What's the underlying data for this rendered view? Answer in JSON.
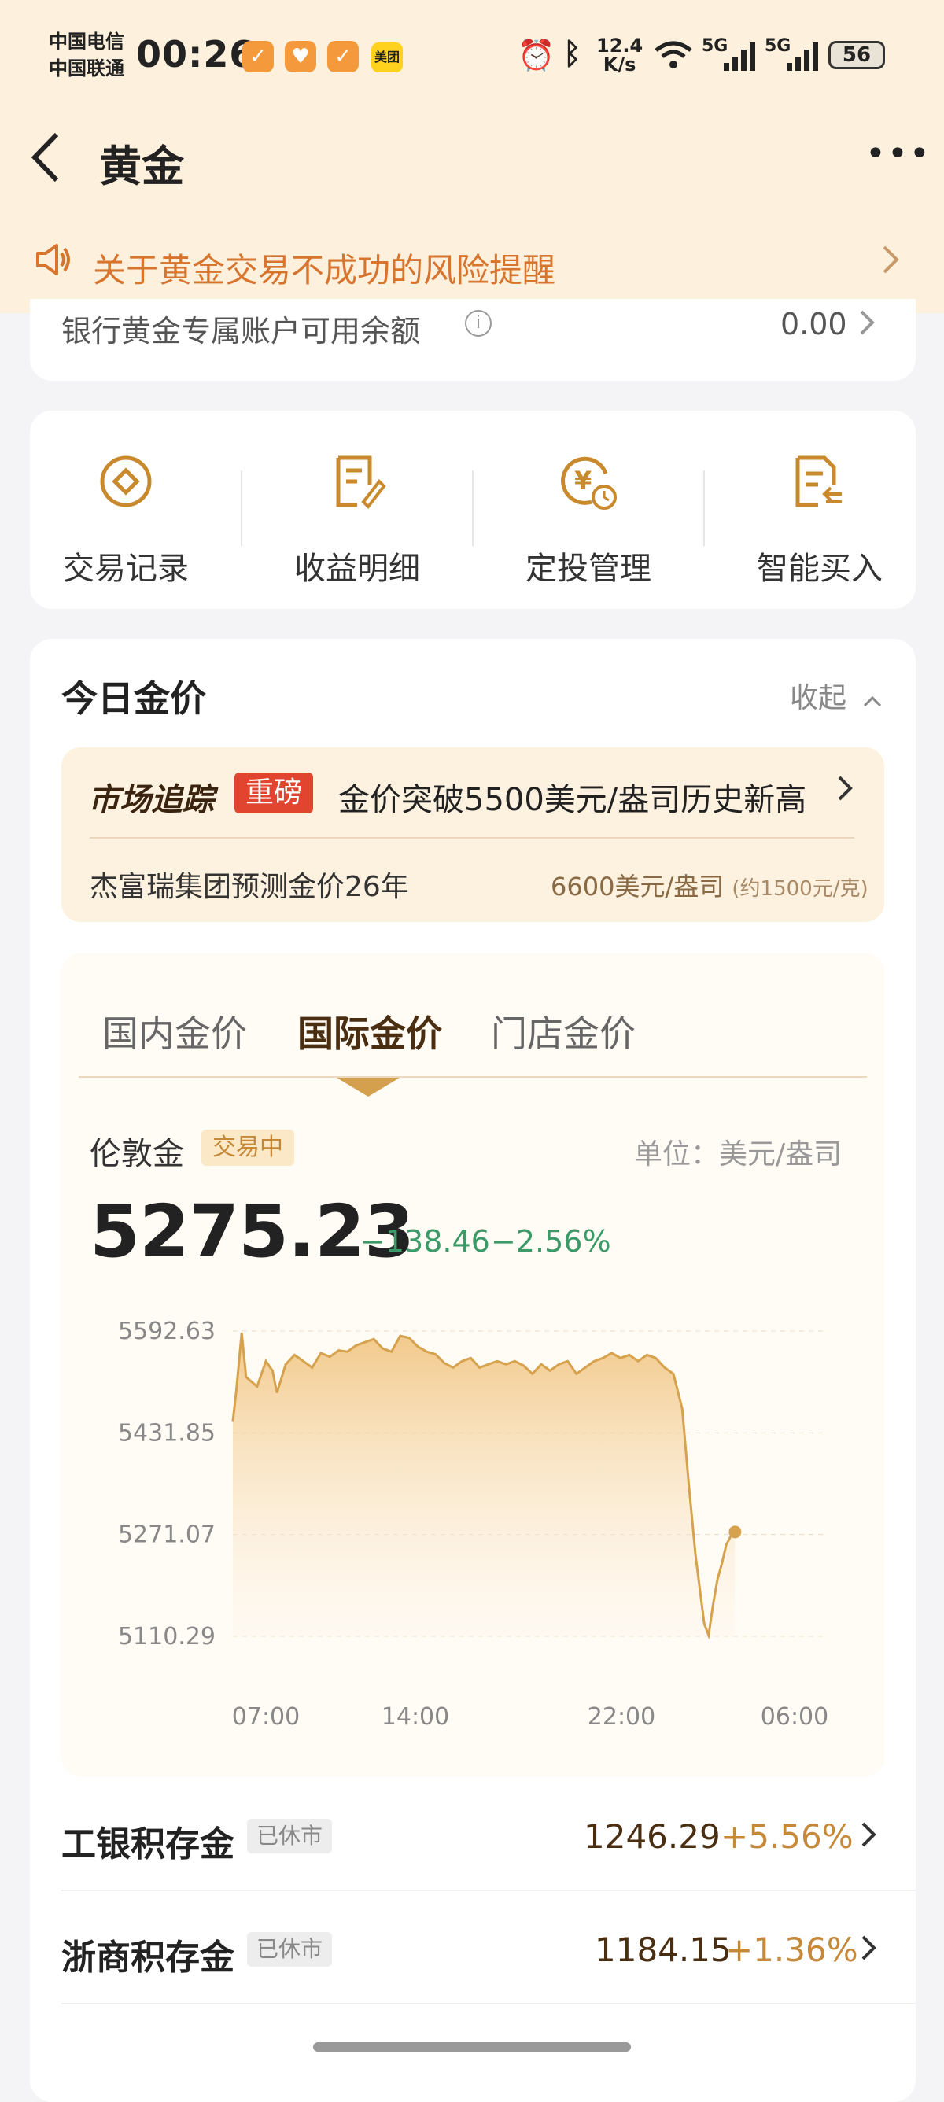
{
  "status_bar": {
    "carrier_1": "中国电信",
    "carrier_2": "中国联通",
    "time": "00:26",
    "meituan": "美团",
    "speed_value": "12.4",
    "speed_unit": "K/s",
    "net_1": "5G",
    "net_2": "5G",
    "battery": "56"
  },
  "header": {
    "title": "黄金"
  },
  "notice": {
    "text": "关于黄金交易不成功的风险提醒"
  },
  "balance": {
    "label": "银行黄金专属账户可用余额",
    "value": "0.00"
  },
  "functions": [
    {
      "label": "交易记录",
      "icon": "record-icon"
    },
    {
      "label": "收益明细",
      "icon": "income-detail-icon"
    },
    {
      "label": "定投管理",
      "icon": "fixed-invest-icon"
    },
    {
      "label": "智能买入",
      "icon": "smart-buy-icon"
    }
  ],
  "today": {
    "title": "今日金价",
    "collapse": "收起",
    "news": {
      "logo": "市场追踪",
      "badge": "重磅",
      "headline": "金价突破5500美元/盎司历史新高",
      "sub": "杰富瑞集团预测金价26年",
      "value": "6600美元/盎司",
      "value_sub": "(约1500元/克)"
    },
    "tabs": [
      "国内金价",
      "国际金价",
      "门店金价"
    ],
    "quote": {
      "name": "伦敦金",
      "status": "交易中",
      "unit": "单位：美元/盎司",
      "price": "5275.23",
      "change": "−138.46",
      "pct": "−2.56%"
    }
  },
  "chart_data": {
    "type": "area",
    "y_ticks": [
      "5592.63",
      "5431.85",
      "5271.07",
      "5110.29"
    ],
    "x_ticks": [
      "07:00",
      "14:00",
      "22:00",
      "06:00"
    ],
    "ylim": [
      5110.29,
      5592.63
    ],
    "series": [
      {
        "values": [
          [
            0,
            5450
          ],
          [
            0.08,
            5500
          ],
          [
            0.2,
            5590
          ],
          [
            0.3,
            5520
          ],
          [
            0.55,
            5505
          ],
          [
            0.75,
            5545
          ],
          [
            0.9,
            5530
          ],
          [
            1.0,
            5495
          ],
          [
            1.2,
            5540
          ],
          [
            1.4,
            5555
          ],
          [
            1.6,
            5545
          ],
          [
            1.8,
            5535
          ],
          [
            2.0,
            5558
          ],
          [
            2.2,
            5552
          ],
          [
            2.4,
            5562
          ],
          [
            2.6,
            5560
          ],
          [
            2.8,
            5570
          ],
          [
            3.0,
            5575
          ],
          [
            3.2,
            5580
          ],
          [
            3.4,
            5565
          ],
          [
            3.6,
            5560
          ],
          [
            3.8,
            5585
          ],
          [
            4.0,
            5582
          ],
          [
            4.2,
            5568
          ],
          [
            4.4,
            5560
          ],
          [
            4.6,
            5556
          ],
          [
            4.8,
            5542
          ],
          [
            5.0,
            5535
          ],
          [
            5.2,
            5545
          ],
          [
            5.4,
            5550
          ],
          [
            5.6,
            5535
          ],
          [
            5.8,
            5540
          ],
          [
            6.0,
            5545
          ],
          [
            6.2,
            5540
          ],
          [
            6.4,
            5545
          ],
          [
            6.6,
            5538
          ],
          [
            6.8,
            5525
          ],
          [
            7.0,
            5540
          ],
          [
            7.2,
            5530
          ],
          [
            7.4,
            5540
          ],
          [
            7.6,
            5545
          ],
          [
            7.8,
            5525
          ],
          [
            8.0,
            5535
          ],
          [
            8.2,
            5545
          ],
          [
            8.4,
            5550
          ],
          [
            8.6,
            5558
          ],
          [
            8.8,
            5550
          ],
          [
            9.0,
            5555
          ],
          [
            9.2,
            5545
          ],
          [
            9.4,
            5555
          ],
          [
            9.6,
            5550
          ],
          [
            9.8,
            5535
          ],
          [
            10.0,
            5525
          ],
          [
            10.2,
            5470
          ],
          [
            10.35,
            5350
          ],
          [
            10.5,
            5240
          ],
          [
            10.6,
            5185
          ],
          [
            10.7,
            5130
          ],
          [
            10.8,
            5112
          ],
          [
            10.9,
            5160
          ],
          [
            11.0,
            5200
          ],
          [
            11.1,
            5225
          ],
          [
            11.2,
            5255
          ],
          [
            11.3,
            5268
          ],
          [
            11.4,
            5275.23
          ]
        ]
      }
    ]
  },
  "rows": [
    {
      "name": "工银积存金",
      "status": "已休市",
      "price": "1246.29",
      "pct": "+5.56%"
    },
    {
      "name": "浙商积存金",
      "status": "已休市",
      "price": "1184.15",
      "pct": "+1.36%"
    }
  ]
}
